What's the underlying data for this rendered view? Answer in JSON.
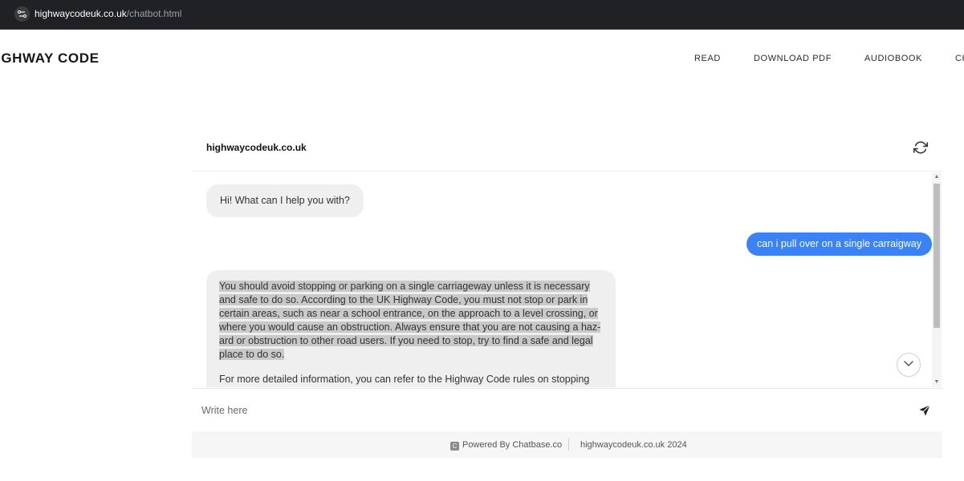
{
  "browser": {
    "url_host": "highwaycodeuk.co.uk",
    "url_path": "/chatbot.html"
  },
  "site": {
    "title": "IGHWAY CODE",
    "nav": [
      "READ",
      "DOWNLOAD PDF",
      "AUDIOBOOK",
      "CH"
    ]
  },
  "chat": {
    "title": "highwaycodeuk.co.uk",
    "messages": {
      "bot_greeting": "Hi! What can I help you with?",
      "user_question": "can i pull over on a single carraigway",
      "bot_answer_p1": "You should avoid stopping or parking on a single carriageway unless it is necessary and safe to do so. According to the UK Highway Code, you must not stop or park in certain areas, such as near a school entrance, on the approach to a level crossing, or where you would cause an obstruction. Always ensure that you are not causing a haz-ard or obstruction to other road users. If you need to stop, try to find a safe and legal place to do so.",
      "bot_answer_p2": "For more detailed information, you can refer to the Highway Code rules on stopping"
    },
    "input_placeholder": "Write here",
    "footer": {
      "powered_by": "Powered By Chatbase.co",
      "copyright": "highwaycodeuk.co.uk 2024"
    }
  },
  "colors": {
    "user_bubble": "#3b82f6",
    "bot_bubble": "#efefef",
    "highlight": "#c9c9c9"
  },
  "icons": [
    "site-info-icon",
    "refresh-icon",
    "chevron-down-icon",
    "send-icon",
    "chatbase-logo-icon"
  ]
}
